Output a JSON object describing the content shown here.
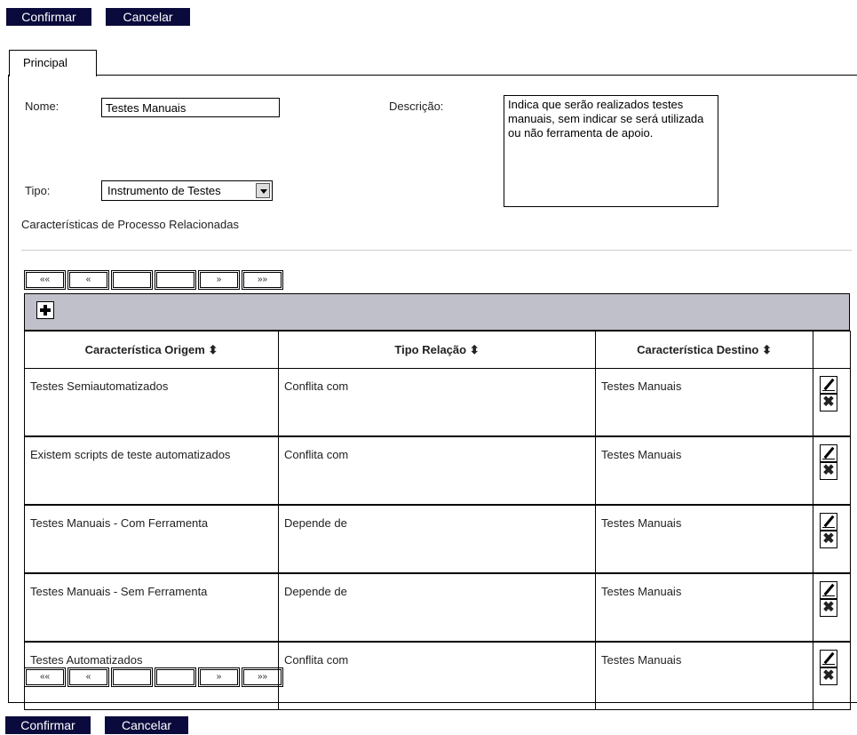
{
  "top_actions": {
    "confirm": "Confirmar",
    "cancel": "Cancelar"
  },
  "bottom_actions": {
    "confirm": "Confirmar",
    "cancel": "Cancelar"
  },
  "tabs": [
    {
      "label": "Principal",
      "active": true
    }
  ],
  "form": {
    "nome_label": "Nome:",
    "nome_value": "Testes Manuais",
    "descricao_label": "Descrição:",
    "descricao_value": "Indica que serão realizados testes manuais, sem indicar se será utilizada ou não ferramenta de apoio.",
    "tipo_label": "Tipo:",
    "tipo_value": "Instrumento de Testes"
  },
  "section_title": "Características de Processo Relacionadas",
  "pager": {
    "first": "««",
    "prev": "«",
    "page1": "",
    "page2": "",
    "next": "»",
    "last": "»»"
  },
  "table": {
    "headers": [
      "Característica Origem ⬍",
      "Tipo Relação ⬍",
      "Característica Destino ⬍",
      ""
    ],
    "rows": [
      {
        "origem": "Testes Semiautomatizados",
        "tipo": "Conflita com",
        "destino": "Testes Manuais"
      },
      {
        "origem": "Existem scripts de teste automatizados",
        "tipo": "Conflita com",
        "destino": "Testes Manuais"
      },
      {
        "origem": "Testes Manuais - Com Ferramenta",
        "tipo": "Depende de",
        "destino": "Testes Manuais"
      },
      {
        "origem": "Testes Manuais - Sem Ferramenta",
        "tipo": "Depende de",
        "destino": "Testes Manuais"
      },
      {
        "origem": "Testes Automatizados",
        "tipo": "Conflita com",
        "destino": "Testes Manuais"
      }
    ],
    "delete_glyph": "✖"
  },
  "colors": {
    "button_bg": "#0a0a3c",
    "toolbar_bg": "#c0c0ca"
  },
  "icons": {
    "add": "plus-icon",
    "edit": "pencil-icon",
    "delete": "x-icon"
  }
}
